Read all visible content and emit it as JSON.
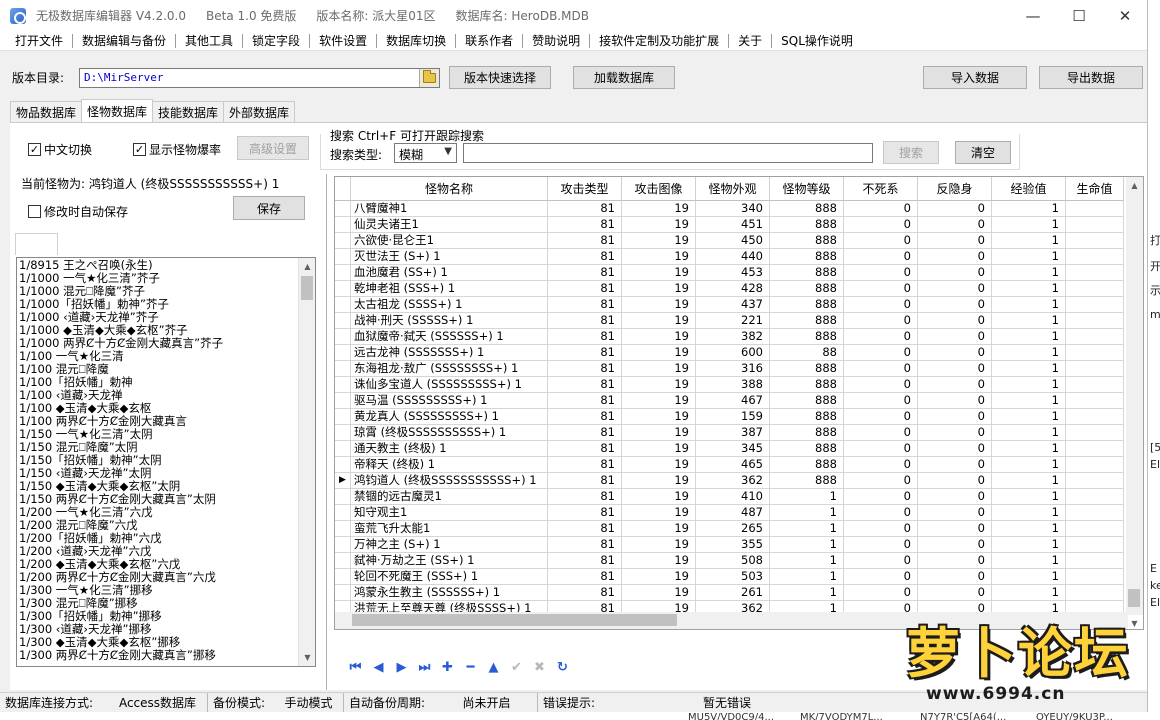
{
  "titlebar": {
    "segments": [
      "无极数据库编辑器 V4.2.0.0",
      "Beta 1.0 免费版",
      "版本名称: 派大星01区",
      "数据库名: HeroDB.MDB"
    ],
    "minimize": "—",
    "maximize": "☐",
    "close": "✕"
  },
  "menu": [
    "打开文件",
    "数据编辑与备份",
    "其他工具",
    "锁定字段",
    "软件设置",
    "数据库切换",
    "联系作者",
    "赞助说明",
    "接软件定制及功能扩展",
    "关于",
    "SQL操作说明"
  ],
  "toolbar": {
    "version_dir_label": "版本目录:",
    "version_dir_value": "D:\\MirServer",
    "quick_select": "版本快速选择",
    "load_db": "加载数据库",
    "import": "导入数据",
    "export": "导出数据"
  },
  "tabs": [
    "物品数据库",
    "怪物数据库",
    "技能数据库",
    "外部数据库"
  ],
  "active_tab": 1,
  "options": {
    "chinese_switch": "中文切换",
    "show_drop_rate": "显示怪物爆率",
    "advanced": "高级设置",
    "auto_save": "修改时自动保存",
    "save": "保存"
  },
  "search": {
    "legend": "搜索  Ctrl+F 可打开跟踪搜索",
    "type_label": "搜索类型:",
    "type_value": "模糊",
    "value": "",
    "search_btn": "搜索",
    "clear_btn": "清空"
  },
  "current_monster": "当前怪物为: 鸿钧道人 (终极SSSSSSSSSSS+) 1",
  "drop_list": [
    "1/8915 王之ぺ召唤(永生)",
    "1/1000 一气★化三清”芥子",
    "1/1000 混元⎕降魔”芥子",
    "1/1000「招妖幡」勅神”芥子",
    "1/1000 ‹道藏›天龙禅”芥子",
    "1/1000 ◆玉清◆大乘◆玄枢”芥子",
    "1/1000 两界Ȼ十方Ȼ金刚大藏真言”芥子",
    "1/100 一气★化三清",
    "1/100 混元⎕降魔",
    "1/100「招妖幡」勅神",
    "1/100 ‹道藏›天龙禅",
    "1/100 ◆玉清◆大乘◆玄枢",
    "1/100 两界Ȼ十方Ȼ金刚大藏真言",
    "1/150 一气★化三清”太阴",
    "1/150 混元⎕降魔”太阴",
    "1/150「招妖幡」勅神”太阴",
    "1/150 ‹道藏›天龙禅”太阴",
    "1/150 ◆玉清◆大乘◆玄枢”太阴",
    "1/150 两界Ȼ十方Ȼ金刚大藏真言”太阴",
    "1/200 一气★化三清”六戊",
    "1/200 混元⎕降魔”六戊",
    "1/200「招妖幡」勅神”六戊",
    "1/200 ‹道藏›天龙禅”六戊",
    "1/200 ◆玉清◆大乘◆玄枢”六戊",
    "1/200 两界Ȼ十方Ȼ金刚大藏真言”六戊",
    "1/300 一气★化三清”挪移",
    "1/300 混元⎕降魔”挪移",
    "1/300「招妖幡」勅神”挪移",
    "1/300 ‹道藏›天龙禅”挪移",
    "1/300 ◆玉清◆大乘◆玄枢”挪移",
    "1/300 两界Ȼ十方Ȼ金刚大藏真言”挪移"
  ],
  "grid": {
    "columns": [
      "怪物名称",
      "攻击类型",
      "攻击图像",
      "怪物外观",
      "怪物等级",
      "不死系",
      "反隐身",
      "经验值",
      "生命值"
    ],
    "current_row": 17,
    "rows": [
      [
        "八臂魔神1",
        "81",
        "19",
        "340",
        "888",
        "0",
        "0",
        "1"
      ],
      [
        "仙灵夫诸王1",
        "81",
        "19",
        "451",
        "888",
        "0",
        "0",
        "1"
      ],
      [
        "六欲使·昆仑王1",
        "81",
        "19",
        "450",
        "888",
        "0",
        "0",
        "1"
      ],
      [
        "灭世法王 (S+) 1",
        "81",
        "19",
        "440",
        "888",
        "0",
        "0",
        "1"
      ],
      [
        "血池魔君 (SS+) 1",
        "81",
        "19",
        "453",
        "888",
        "0",
        "0",
        "1"
      ],
      [
        "乾坤老祖 (SSS+) 1",
        "81",
        "19",
        "428",
        "888",
        "0",
        "0",
        "1"
      ],
      [
        "太古祖龙 (SSSS+) 1",
        "81",
        "19",
        "437",
        "888",
        "0",
        "0",
        "1"
      ],
      [
        "战神·刑天 (SSSSS+) 1",
        "81",
        "19",
        "221",
        "888",
        "0",
        "0",
        "1"
      ],
      [
        "血狱魔帝·弑天 (SSSSSS+) 1",
        "81",
        "19",
        "382",
        "888",
        "0",
        "0",
        "1"
      ],
      [
        "远古龙神 (SSSSSSS+) 1",
        "81",
        "19",
        "600",
        "88",
        "0",
        "0",
        "1"
      ],
      [
        "东海祖龙·敖广 (SSSSSSSS+) 1",
        "81",
        "19",
        "316",
        "888",
        "0",
        "0",
        "1"
      ],
      [
        "诛仙多宝道人 (SSSSSSSSS+) 1",
        "81",
        "19",
        "388",
        "888",
        "0",
        "0",
        "1"
      ],
      [
        "驱马温 (SSSSSSSSS+) 1",
        "81",
        "19",
        "467",
        "888",
        "0",
        "0",
        "1"
      ],
      [
        "黄龙真人 (SSSSSSSSS+) 1",
        "81",
        "19",
        "159",
        "888",
        "0",
        "0",
        "1"
      ],
      [
        "琼霄 (终极SSSSSSSSSS+) 1",
        "81",
        "19",
        "387",
        "888",
        "0",
        "0",
        "1"
      ],
      [
        "通天教主 (终极) 1",
        "81",
        "19",
        "345",
        "888",
        "0",
        "0",
        "1"
      ],
      [
        "帝释天 (终极) 1",
        "81",
        "19",
        "465",
        "888",
        "0",
        "0",
        "1"
      ],
      [
        "鸿钧道人 (终极SSSSSSSSSSS+) 1",
        "81",
        "19",
        "362",
        "888",
        "0",
        "0",
        "1"
      ],
      [
        "禁锢的远古魔灵1",
        "81",
        "19",
        "410",
        "1",
        "0",
        "0",
        "1"
      ],
      [
        "知守观主1",
        "81",
        "19",
        "487",
        "1",
        "0",
        "0",
        "1"
      ],
      [
        "蛮荒飞升太能1",
        "81",
        "19",
        "265",
        "1",
        "0",
        "0",
        "1"
      ],
      [
        "万神之主 (S+) 1",
        "81",
        "19",
        "355",
        "1",
        "0",
        "0",
        "1"
      ],
      [
        "弑神·万劫之王 (SS+) 1",
        "81",
        "19",
        "508",
        "1",
        "0",
        "0",
        "1"
      ],
      [
        "轮回不死魔王 (SSS+) 1",
        "81",
        "19",
        "503",
        "1",
        "0",
        "0",
        "1"
      ],
      [
        "鸿蒙永生教主 (SSSSSS+) 1",
        "81",
        "19",
        "261",
        "1",
        "0",
        "0",
        "1"
      ],
      [
        "洪荒无上至尊天尊 (终极SSSS+) 1",
        "81",
        "19",
        "362",
        "1",
        "0",
        "0",
        "1"
      ]
    ]
  },
  "navigator": [
    "first",
    "prior",
    "next",
    "last",
    "insert",
    "delete",
    "edit",
    "post",
    "cancel",
    "refresh"
  ],
  "statusbar": {
    "conn_label": "数据库连接方式:",
    "conn_value": "Access数据库",
    "backup_label": "备份模式:",
    "backup_value": "手动模式",
    "period_label": "自动备份周期:",
    "period_value": "尚未开启",
    "error_label": "错误提示:",
    "error_value": "暂无错误"
  },
  "background": {
    "right_text": [
      "打",
      "开",
      "示",
      "ms",
      "[5",
      "Ele",
      "E",
      "ke",
      "Ele"
    ],
    "bottom_text": [
      "MU5V/VD0C9/4...",
      "MK/7VODYM7L...",
      "N7Y7R'C5[A64(...",
      "OYEUY/9KU3P..."
    ]
  },
  "watermark": {
    "logo": "萝卜论坛",
    "url": "www.6994.cn"
  },
  "colors": {
    "accent_blue": "#2a5bd6",
    "logo_yellow": "#ffd23a"
  }
}
